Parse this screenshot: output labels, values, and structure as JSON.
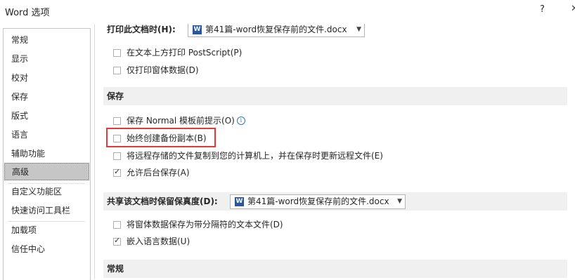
{
  "window": {
    "title": "Word 选项",
    "help": "?",
    "close": "✕"
  },
  "nav": {
    "items": [
      {
        "label": "常规"
      },
      {
        "label": "显示"
      },
      {
        "label": "校对"
      },
      {
        "label": "保存"
      },
      {
        "label": "版式"
      },
      {
        "label": "语言"
      },
      {
        "label": "辅助功能"
      },
      {
        "label": "高级",
        "active": true
      },
      {
        "label": "自定义功能区"
      },
      {
        "label": "快速访问工具栏"
      },
      {
        "label": "加载项"
      },
      {
        "label": "信任中心"
      }
    ]
  },
  "print": {
    "doc_label": "打印此文档时(H):",
    "doc_dropdown": "第41篇-word恢复保存前的文件.docx",
    "options": [
      {
        "label": "在文本上方打印 PostScript(P)",
        "checked": false
      },
      {
        "label": "仅打印窗体数据(D)",
        "checked": false
      }
    ]
  },
  "save": {
    "header": "保存",
    "options": [
      {
        "label": "保存 Normal 模板前提示(O)",
        "checked": false,
        "info": "i"
      },
      {
        "label": "始终创建备份副本(B)",
        "checked": false
      },
      {
        "label": "将远程存储的文件复制到您的计算机上，并在保存时更新远程文件(E)",
        "checked": false
      },
      {
        "label": "允许后台保存(A)",
        "checked": true
      }
    ]
  },
  "share": {
    "label": "共享该文档时保留保真度(D):",
    "dropdown": "第41篇-word恢复保存前的文件.docx",
    "options": [
      {
        "label": "将窗体数据保存为带分隔符的文本文件(D)",
        "checked": false
      },
      {
        "label": "嵌入语言数据(U)",
        "checked": true
      }
    ]
  },
  "general": {
    "header": "常规"
  },
  "icons": {
    "doc": "word-doc-icon",
    "caret": "▼"
  },
  "colors": {
    "highlight": "#e53935",
    "section_bg": "#f0f0f0",
    "nav_active": "#c6c6c6"
  }
}
